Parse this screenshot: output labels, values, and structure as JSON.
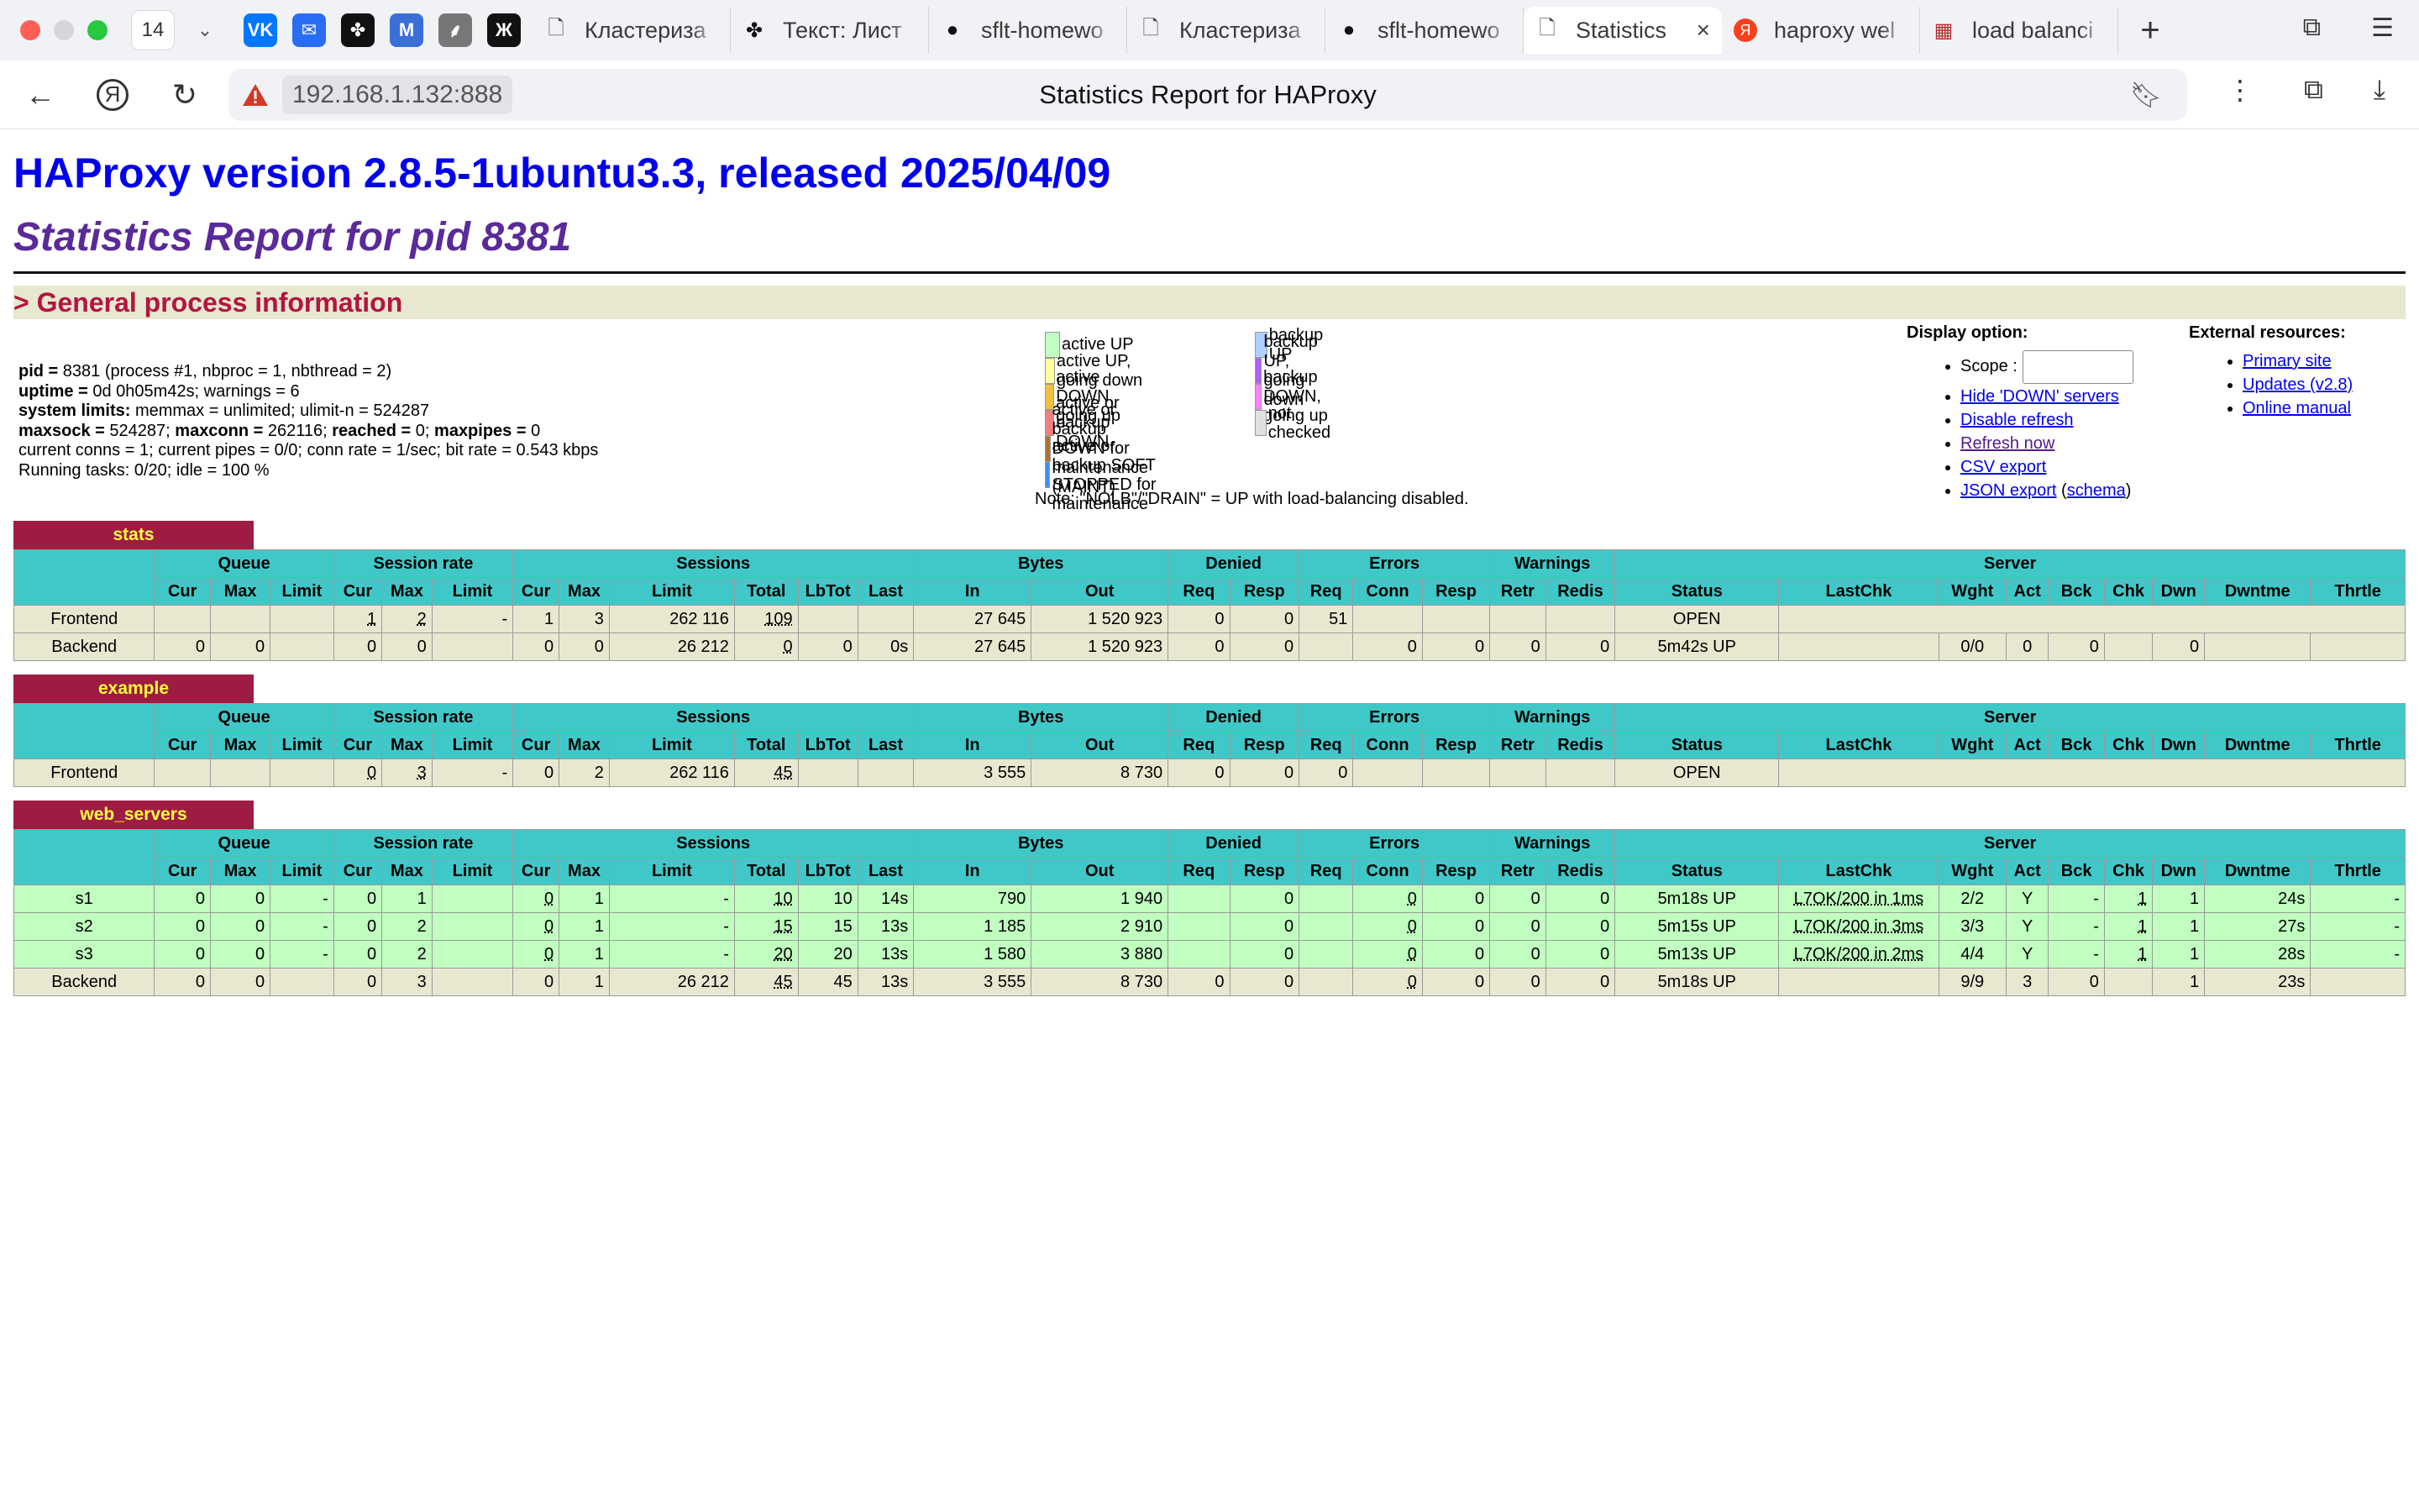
{
  "browser": {
    "tab_count": "14",
    "pinned": [
      {
        "icon": "vk-icon",
        "glyph": "VK",
        "color": "#0077ff"
      },
      {
        "icon": "mail-icon",
        "glyph": "✉",
        "color": "#2a6df5"
      },
      {
        "icon": "dots-icon",
        "glyph": "✤",
        "color": "#111111"
      },
      {
        "icon": "m-icon",
        "glyph": "M",
        "color": "#3a6fd8"
      },
      {
        "icon": "feather-icon",
        "glyph": "⸙",
        "color": "#777777"
      },
      {
        "icon": "zh-icon",
        "glyph": "Ж",
        "color": "#111111"
      }
    ],
    "tabs": [
      {
        "title": "Кластериза",
        "icon": "page-icon"
      },
      {
        "title": "Текст: Лист",
        "icon": "dots-icon"
      },
      {
        "title": "sflt-homewo",
        "icon": "github-icon"
      },
      {
        "title": "Кластериза",
        "icon": "page-icon"
      },
      {
        "title": "sflt-homewo",
        "icon": "github-icon"
      },
      {
        "title": "Statistics",
        "icon": "page-icon",
        "active": true
      },
      {
        "title": "haproxy wel",
        "icon": "yandex-icon"
      },
      {
        "title": "load balanci",
        "icon": "grid-icon"
      }
    ],
    "url_host": "192.168.1.132:888",
    "page_title": "Statistics Report for HAProxy"
  },
  "page": {
    "version_heading": "HAProxy version 2.8.5-1ubuntu3.3, released 2025/04/09",
    "pid_heading": "Statistics Report for pid 8381",
    "general_heading": "> General process information",
    "procinfo": [
      {
        "label": "pid = ",
        "text": "8381 (process #1, nbproc = 1, nbthread = 2)"
      },
      {
        "label": "uptime = ",
        "text": "0d 0h05m42s; warnings = 6"
      },
      {
        "label": "system limits:",
        "text": " memmax = unlimited; ulimit-n = 524287"
      },
      {
        "label": "maxsock = ",
        "text": "524287; "
      },
      {
        "label": "",
        "text": "current conns = 1; current pipes = 0/0; conn rate = 1/sec; bit rate = 0.543 kbps"
      },
      {
        "label": "",
        "text": "Running tasks: 0/20; idle = 100 %"
      }
    ],
    "maxsock_line": {
      "maxsock_label": "maxsock = ",
      "maxsock": "524287; ",
      "maxconn_label": "maxconn = ",
      "maxconn": "262116; ",
      "reached_label": "reached = ",
      "reached": "0; ",
      "maxpipes_label": "maxpipes = ",
      "maxpipes": "0"
    },
    "legend": {
      "col1": [
        {
          "label": "active UP",
          "color": "#c0ffc0"
        },
        {
          "label": "active UP, going down",
          "color": "#ffffa0"
        },
        {
          "label": "active DOWN, going up",
          "color": "#f0c040"
        },
        {
          "label": "active or backup DOWN",
          "color": "#f08080"
        },
        {
          "label": "active or backup DOWN for maintenance (MAINT)",
          "color": "#b07030"
        },
        {
          "label": "active or backup SOFT STOPPED for maintenance",
          "color": "#4090f0"
        }
      ],
      "col2": [
        {
          "label": "backup UP",
          "color": "#b0d0ff"
        },
        {
          "label": "backup UP, going down",
          "color": "#b060f0"
        },
        {
          "label": "backup DOWN, going up",
          "color": "#ff80ff"
        },
        {
          "label": "not checked",
          "color": "#e0e0e0"
        }
      ],
      "note": "Note: \"NOLB\"/\"DRAIN\" = UP with load-balancing disabled."
    },
    "display_option": {
      "heading": "Display option:",
      "scope_label": "Scope :",
      "links": [
        "Hide 'DOWN' servers",
        "Disable refresh",
        "Refresh now",
        "CSV export",
        "JSON export"
      ],
      "schema_link": "schema"
    },
    "external": {
      "heading": "External resources:",
      "links": [
        "Primary site",
        "Updates (v2.8)",
        "Online manual"
      ]
    }
  },
  "table_headers": {
    "groups": [
      "Queue",
      "Session rate",
      "Sessions",
      "Bytes",
      "Denied",
      "Errors",
      "Warnings",
      "Server"
    ],
    "sub": [
      "Cur",
      "Max",
      "Limit",
      "Cur",
      "Max",
      "Limit",
      "Cur",
      "Max",
      "Limit",
      "Total",
      "LbTot",
      "Last",
      "In",
      "Out",
      "Req",
      "Resp",
      "Req",
      "Conn",
      "Resp",
      "Retr",
      "Redis",
      "Status",
      "LastChk",
      "Wght",
      "Act",
      "Bck",
      "Chk",
      "Dwn",
      "Dwntme",
      "Thrtle"
    ]
  },
  "proxies": [
    {
      "name": "stats",
      "rows": [
        {
          "kind": "fe",
          "cells": [
            "Frontend",
            "",
            "",
            "",
            "1",
            "2",
            "-",
            "1",
            "3",
            "262 116",
            "109",
            "",
            "",
            "27 645",
            "1 520 923",
            "0",
            "0",
            "51",
            "",
            "",
            "",
            "",
            "OPEN",
            "",
            "",
            "",
            "",
            "",
            "",
            "",
            ""
          ]
        },
        {
          "kind": "be",
          "cells": [
            "Backend",
            "0",
            "0",
            "",
            "0",
            "0",
            "",
            "0",
            "0",
            "26 212",
            "0",
            "0",
            "0s",
            "27 645",
            "1 520 923",
            "0",
            "0",
            "",
            "0",
            "0",
            "0",
            "0",
            "5m42s UP",
            "",
            "0/0",
            "0",
            "0",
            "",
            "0",
            "",
            ""
          ]
        }
      ]
    },
    {
      "name": "example",
      "rows": [
        {
          "kind": "fe",
          "cells": [
            "Frontend",
            "",
            "",
            "",
            "0",
            "3",
            "-",
            "0",
            "2",
            "262 116",
            "45",
            "",
            "",
            "3 555",
            "8 730",
            "0",
            "0",
            "0",
            "",
            "",
            "",
            "",
            "OPEN",
            "",
            "",
            "",
            "",
            "",
            "",
            "",
            ""
          ]
        }
      ]
    },
    {
      "name": "web_servers",
      "rows": [
        {
          "kind": "up",
          "cells": [
            "s1",
            "0",
            "0",
            "-",
            "0",
            "1",
            "",
            "0",
            "1",
            "-",
            "10",
            "10",
            "14s",
            "790",
            "1 940",
            "",
            "0",
            "",
            "0",
            "0",
            "0",
            "0",
            "5m18s UP",
            "L7OK/200 in 1ms",
            "2/2",
            "Y",
            "-",
            "1",
            "1",
            "24s",
            "-"
          ]
        },
        {
          "kind": "up",
          "cells": [
            "s2",
            "0",
            "0",
            "-",
            "0",
            "2",
            "",
            "0",
            "1",
            "-",
            "15",
            "15",
            "13s",
            "1 185",
            "2 910",
            "",
            "0",
            "",
            "0",
            "0",
            "0",
            "0",
            "5m15s UP",
            "L7OK/200 in 3ms",
            "3/3",
            "Y",
            "-",
            "1",
            "1",
            "27s",
            "-"
          ]
        },
        {
          "kind": "up",
          "cells": [
            "s3",
            "0",
            "0",
            "-",
            "0",
            "2",
            "",
            "0",
            "1",
            "-",
            "20",
            "20",
            "13s",
            "1 580",
            "3 880",
            "",
            "0",
            "",
            "0",
            "0",
            "0",
            "0",
            "5m13s UP",
            "L7OK/200 in 2ms",
            "4/4",
            "Y",
            "-",
            "1",
            "1",
            "28s",
            "-"
          ]
        },
        {
          "kind": "be",
          "cells": [
            "Backend",
            "0",
            "0",
            "",
            "0",
            "3",
            "",
            "0",
            "1",
            "26 212",
            "45",
            "45",
            "13s",
            "3 555",
            "8 730",
            "0",
            "0",
            "",
            "0",
            "0",
            "0",
            "0",
            "5m18s UP",
            "",
            "9/9",
            "3",
            "0",
            "",
            "1",
            "23s",
            ""
          ]
        }
      ]
    }
  ]
}
